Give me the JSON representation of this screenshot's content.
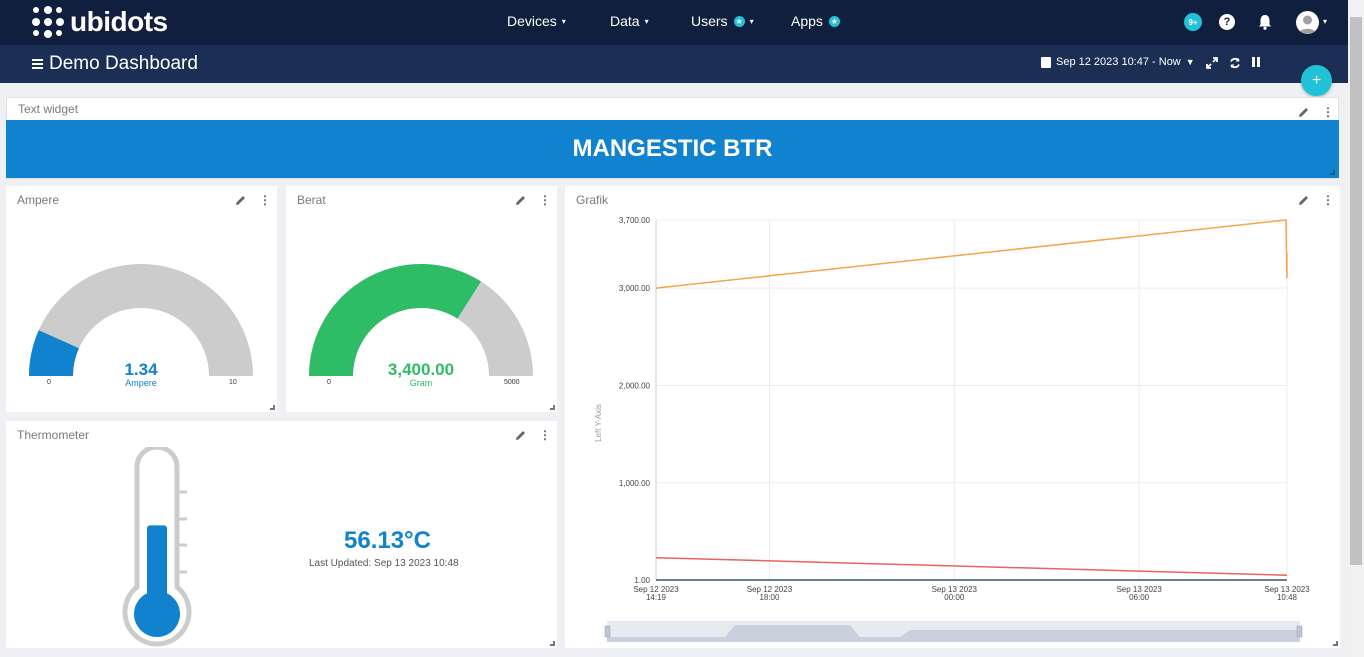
{
  "brand": {
    "name": "ubidots"
  },
  "nav": {
    "items": [
      {
        "label": "Devices",
        "caret": true,
        "badge": false
      },
      {
        "label": "Data",
        "caret": true,
        "badge": false
      },
      {
        "label": "Users",
        "caret": true,
        "badge": true
      },
      {
        "label": "Apps",
        "caret": false,
        "badge": true
      }
    ],
    "notifications_badge": "9+",
    "help_symbol": "?"
  },
  "dashboard": {
    "title": "Demo Dashboard",
    "date_range": "Sep 12 2023 10:47 - Now",
    "add_symbol": "+"
  },
  "widgets": {
    "text_widget": {
      "title": "Text widget",
      "text": "MANGESTIC BTR",
      "color": "#1182ce"
    },
    "ampere": {
      "title": "Ampere",
      "value": "1.34",
      "unit": "Ampere",
      "min": "0",
      "max": "10",
      "fill_fraction": 0.134,
      "color": "#1182ce"
    },
    "berat": {
      "title": "Berat",
      "value": "3,400.00",
      "unit": "Gram",
      "min": "0",
      "max": "5000",
      "fill_fraction": 0.68,
      "color": "#2ebd66"
    },
    "thermometer": {
      "title": "Thermometer",
      "value": "56.13°C",
      "last_updated": "Last Updated: Sep 13 2023 10:48",
      "color": "#1182ce",
      "fill_fraction": 0.5613
    },
    "grafik": {
      "title": "Grafik"
    }
  },
  "chart_data": {
    "type": "line",
    "ylabel": "Left Y-Axis",
    "y_ticks": [
      "3,700.00",
      "3,000.00",
      "2,000.00",
      "1,000.00",
      "1.00"
    ],
    "x_ticks": [
      {
        "date": "Sep 12 2023",
        "time": "14:19"
      },
      {
        "date": "Sep 12 2023",
        "time": "18:00"
      },
      {
        "date": "Sep 13 2023",
        "time": "00:00"
      },
      {
        "date": "Sep 13 2023",
        "time": "06:00"
      },
      {
        "date": "Sep 13 2023",
        "time": "10:48"
      }
    ],
    "ylim": [
      1,
      3700
    ],
    "x_hours": [
      0,
      3.683,
      9.683,
      15.683,
      20.483
    ],
    "series": [
      {
        "color": "#f5a54a",
        "points": [
          [
            0,
            3000
          ],
          [
            20.45,
            3700
          ],
          [
            20.48,
            3100
          ],
          [
            20.48,
            3350
          ],
          [
            20.51,
            3350
          ]
        ]
      },
      {
        "color": "#e8625e",
        "points": [
          [
            0,
            230
          ],
          [
            20.48,
            50
          ]
        ]
      },
      {
        "color": "#40536b",
        "points": [
          [
            0,
            1
          ],
          [
            20.48,
            1
          ]
        ]
      }
    ]
  }
}
